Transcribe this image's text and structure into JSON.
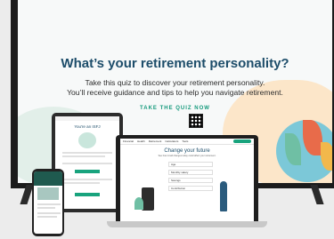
{
  "tv": {
    "headline": "What’s your retirement personality?",
    "subtitle_line1": "Take this quiz to discover your retirement personality.",
    "subtitle_line2": "You’ll receive guidance and tips to help you navigate retirement.",
    "cta": "TAKE THE QUIZ NOW",
    "colors": {
      "headline": "#1d4d6a",
      "accent": "#159a7c"
    }
  },
  "laptop": {
    "nav_items": [
      "Financial",
      "Health",
      "Retirement",
      "Calculators",
      "Tools"
    ],
    "page_title": "Change your future",
    "page_text": "See how small changes today could affect your retirement.",
    "fields": [
      "Age",
      "Monthly salary",
      "Savings",
      "Contribution"
    ]
  },
  "tablet": {
    "page_title": "You're an ISFJ"
  }
}
